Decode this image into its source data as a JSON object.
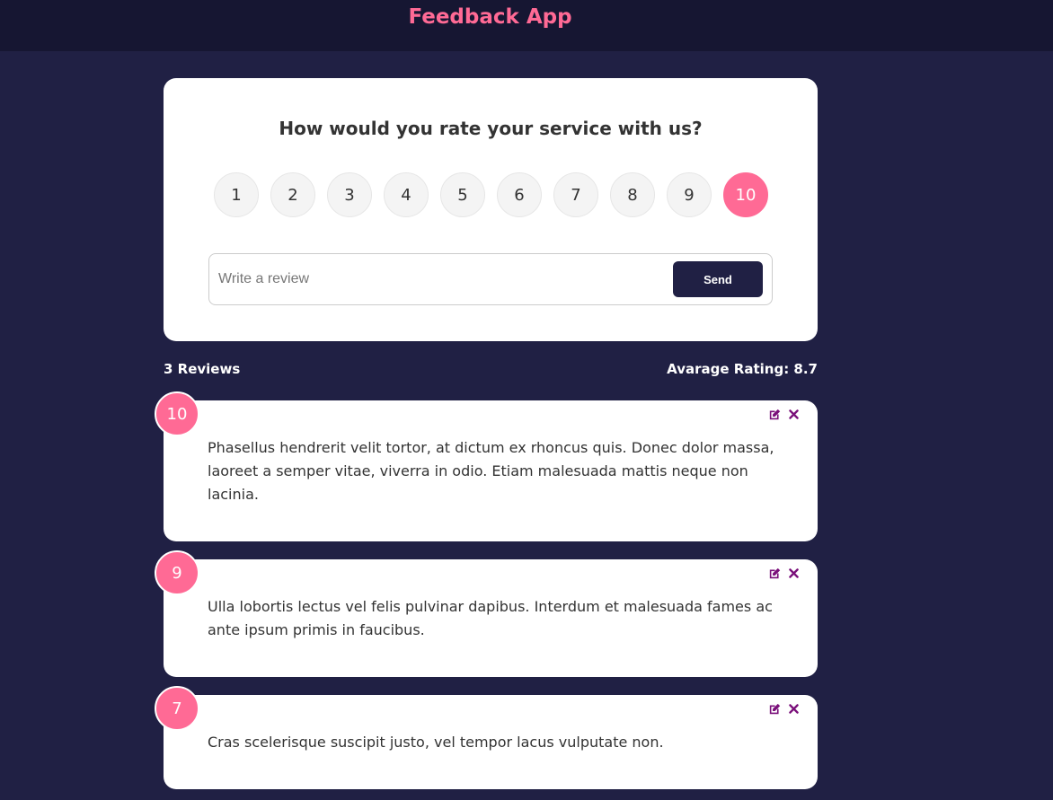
{
  "header": {
    "title": "Feedback App"
  },
  "rating_card": {
    "question": "How would you rate your service with us?",
    "options": [
      "1",
      "2",
      "3",
      "4",
      "5",
      "6",
      "7",
      "8",
      "9",
      "10"
    ],
    "selected": "10",
    "review_placeholder": "Write a review",
    "review_value": "",
    "send_label": "Send"
  },
  "stats": {
    "count_text": "3 Reviews",
    "average_text": "Avarage Rating: 8.7"
  },
  "reviews": [
    {
      "rating": "10",
      "text": "Phasellus hendrerit velit tortor, at dictum ex rhoncus quis. Donec dolor massa, laoreet a semper vitae, viverra in odio. Etiam malesuada mattis neque non lacinia."
    },
    {
      "rating": "9",
      "text": "Ulla lobortis lectus vel felis pulvinar dapibus. Interdum et malesuada fames ac ante ipsum primis in faucibus."
    },
    {
      "rating": "7",
      "text": "Cras scelerisque suscipit justo, vel tempor lacus vulputate non."
    }
  ],
  "icons": {
    "edit": "edit-icon",
    "delete": "close-icon"
  },
  "colors": {
    "accent": "#ff6a95",
    "background": "#202044",
    "header": "#161632",
    "icon": "#7a0f7a"
  }
}
